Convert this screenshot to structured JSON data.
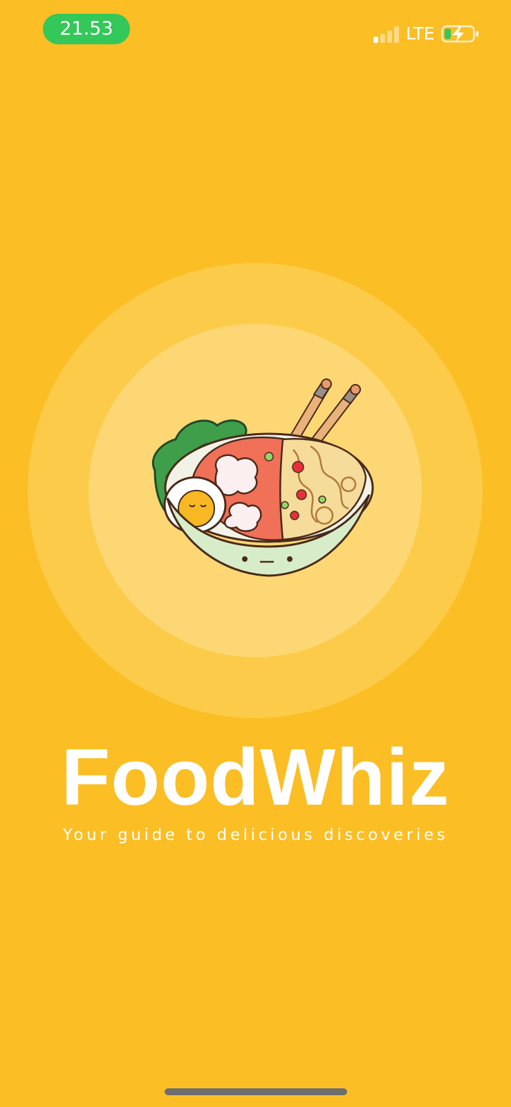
{
  "status_bar": {
    "time": "21.53",
    "network": "LTE",
    "signal_icon": "cellular-signal-icon",
    "battery_icon": "battery-charging-icon",
    "time_pill_color": "#34C759"
  },
  "splash": {
    "app_name": "FoodWhiz",
    "tagline": "Your guide to delicious discoveries",
    "illustration": "ramen-bowl-illustration",
    "background_color": "#FBBE25"
  }
}
